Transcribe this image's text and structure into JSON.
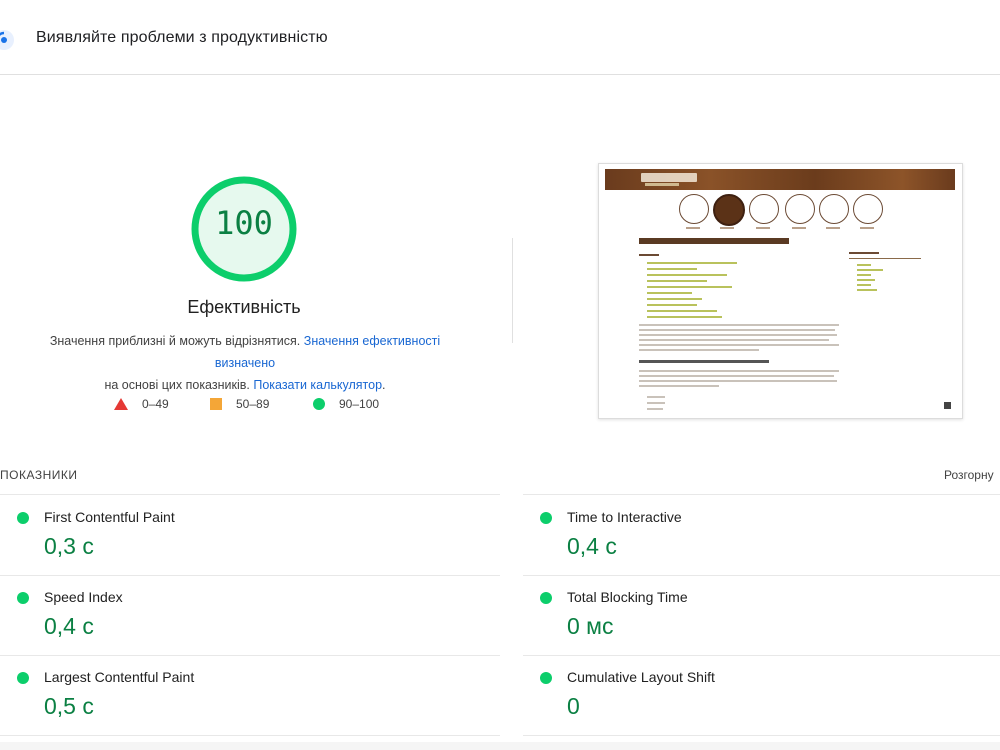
{
  "header": {
    "title": "Виявляйте проблеми з продуктивністю",
    "icon": "lighthouse-icon",
    "accent": "#1a73e8"
  },
  "score": {
    "value": "100",
    "label": "Ефективність",
    "fraction": 1.0,
    "color": "#0cce6b",
    "description_text": "Значення приблизні й можуть відрізнятися. ",
    "description_link1": "Значення ефективності визначено",
    "description_mid": " на основі цих показників. ",
    "description_link2": "Показати калькулятор",
    "description_end": "."
  },
  "legend": [
    {
      "label": "0–49",
      "shape": "triangle",
      "color": "#e53935"
    },
    {
      "label": "50–89",
      "shape": "square",
      "color": "#f4a637"
    },
    {
      "label": "90–100",
      "shape": "circle",
      "color": "#0cce6b"
    }
  ],
  "screenshot": {
    "site_logo": "ProDveri"
  },
  "metrics": {
    "heading": "ПОКАЗНИКИ",
    "expand_label": "Розгорну",
    "items": [
      {
        "name": "First Contentful Paint",
        "value": "0,3 с"
      },
      {
        "name": "Time to Interactive",
        "value": "0,4 с"
      },
      {
        "name": "Speed Index",
        "value": "0,4 с"
      },
      {
        "name": "Total Blocking Time",
        "value": "0 мс"
      },
      {
        "name": "Largest Contentful Paint",
        "value": "0,5 с"
      },
      {
        "name": "Cumulative Layout Shift",
        "value": "0"
      }
    ]
  }
}
